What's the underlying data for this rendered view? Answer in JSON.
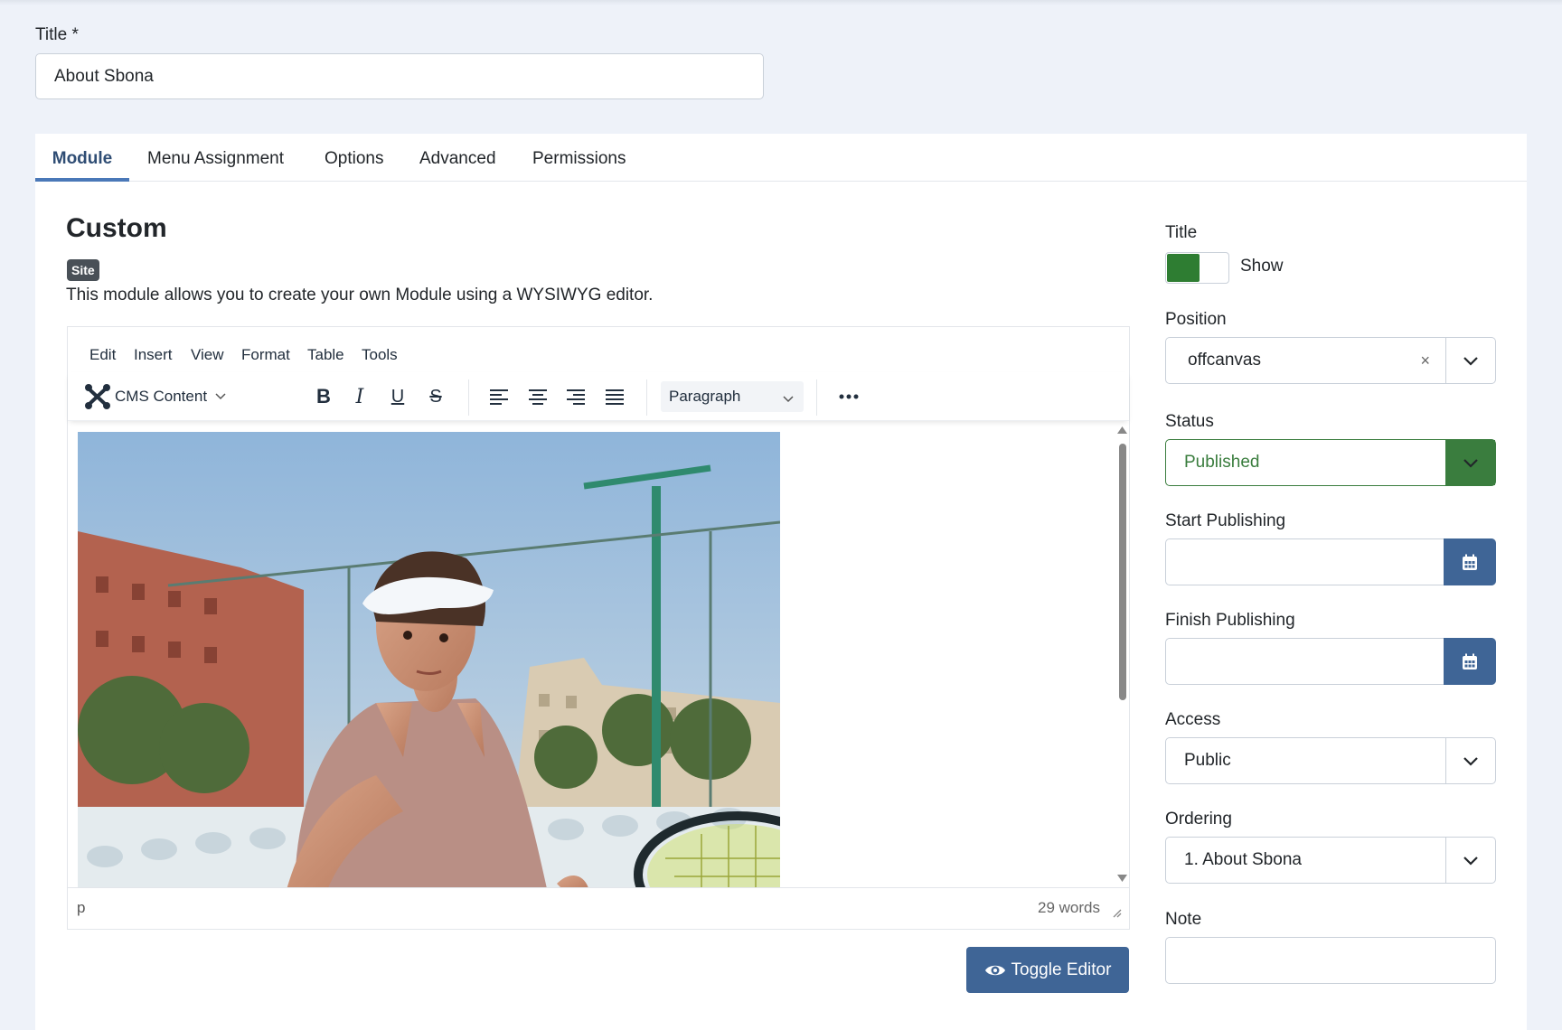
{
  "title_field": {
    "label": "Title *",
    "value": "About Sbona"
  },
  "tabs": [
    {
      "label": "Module"
    },
    {
      "label": "Menu Assignment"
    },
    {
      "label": "Options"
    },
    {
      "label": "Advanced"
    },
    {
      "label": "Permissions"
    }
  ],
  "module": {
    "heading": "Custom",
    "badge": "Site",
    "description": "This module allows you to create your own Module using a WYSIWYG editor."
  },
  "editor": {
    "menu": [
      "Edit",
      "Insert",
      "View",
      "Format",
      "Table",
      "Tools"
    ],
    "cms_content_label": "CMS Content",
    "block_format": "Paragraph",
    "path": "p",
    "word_count": "29 words",
    "toggle_label": "Toggle Editor"
  },
  "sidebar": {
    "title_label": "Title",
    "title_switch_text": "Show",
    "position_label": "Position",
    "position_value": "offcanvas",
    "position_clear": "×",
    "status_label": "Status",
    "status_value": "Published",
    "start_label": "Start Publishing",
    "finish_label": "Finish Publishing",
    "access_label": "Access",
    "access_value": "Public",
    "ordering_label": "Ordering",
    "ordering_value": "1. About Sbona",
    "note_label": "Note"
  },
  "colors": {
    "accent": "#3f6596",
    "published": "#3a7d3e",
    "switch_on": "#2e7d32"
  }
}
